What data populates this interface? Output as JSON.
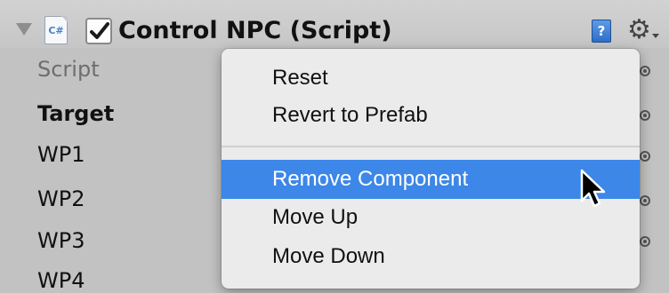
{
  "component": {
    "title": "Control NPC (Script)",
    "enabled": true,
    "cs_icon_text": "C#",
    "help_icon_text": "?"
  },
  "fields": [
    {
      "label": "Script"
    },
    {
      "label": "Target"
    },
    {
      "label": "WP1"
    },
    {
      "label": "WP2"
    },
    {
      "label": "WP3"
    },
    {
      "label": "WP4"
    }
  ],
  "context_menu": {
    "items": [
      {
        "label": "Reset"
      },
      {
        "label": "Revert to Prefab"
      },
      {
        "label": "Remove Component",
        "highlighted": true
      },
      {
        "label": "Move Up"
      },
      {
        "label": "Move Down"
      }
    ]
  },
  "colors": {
    "highlight": "#3c87e8",
    "help_icon": "#3f82d8",
    "background": "#c2c2c2"
  },
  "icons": [
    "foldout-arrow-icon",
    "csharp-script-icon",
    "checkbox-checkmark-icon",
    "help-icon",
    "gear-icon",
    "object-picker-icon",
    "mouse-pointer-icon"
  ]
}
